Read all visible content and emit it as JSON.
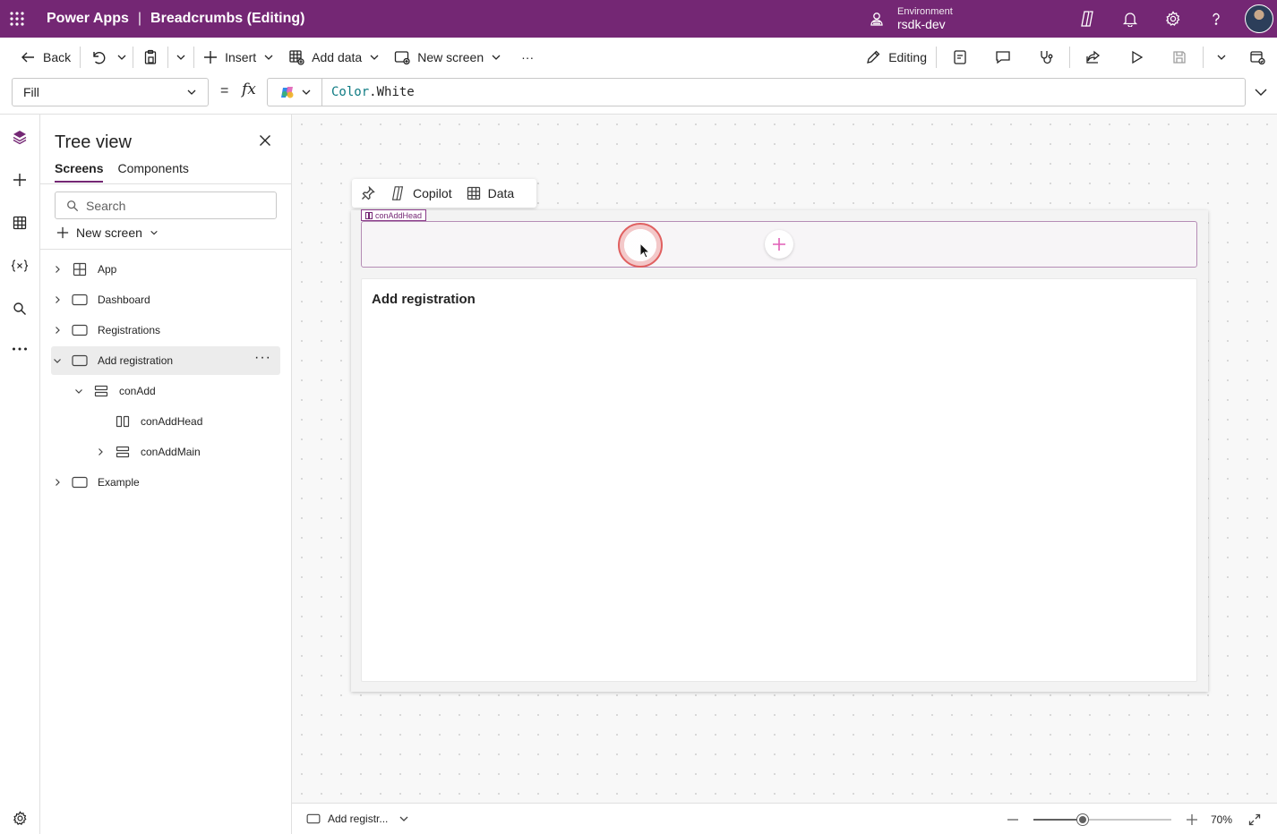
{
  "app": {
    "name": "Power Apps",
    "separator": "|",
    "title": "Breadcrumbs (Editing)"
  },
  "environment": {
    "label": "Environment",
    "value": "rsdk-dev"
  },
  "topbar": {
    "icons": [
      "copilot-icon",
      "bell-icon",
      "gear-icon",
      "help-icon",
      "avatar"
    ]
  },
  "commandbar": {
    "back": "Back",
    "insert": "Insert",
    "add_data": "Add data",
    "new_screen": "New screen",
    "more": "···",
    "editing": "Editing"
  },
  "formula": {
    "property": "Fill",
    "equals": "=",
    "fx": "fx",
    "expression_object": "Color",
    "expression_rest": ".White"
  },
  "treeview": {
    "title": "Tree view",
    "tabs": [
      {
        "label": "Screens",
        "active": true
      },
      {
        "label": "Components",
        "active": false
      }
    ],
    "search_placeholder": "Search",
    "new_screen": "New screen",
    "nodes": [
      {
        "label": "App",
        "icon": "app-icon",
        "expanded": false
      },
      {
        "label": "Dashboard",
        "icon": "screen-icon",
        "expanded": false
      },
      {
        "label": "Registrations",
        "icon": "screen-icon",
        "expanded": false
      },
      {
        "label": "Add registration",
        "icon": "screen-icon",
        "expanded": true,
        "selected": true,
        "more": "···"
      },
      {
        "label": "conAdd",
        "icon": "vertical-container-icon",
        "expanded": true
      },
      {
        "label": "conAddHead",
        "icon": "horizontal-container-icon"
      },
      {
        "label": "conAddMain",
        "icon": "vertical-container-icon",
        "expanded": false
      },
      {
        "label": "Example",
        "icon": "screen-icon",
        "expanded": false
      }
    ]
  },
  "canvas": {
    "toolbar": {
      "copilot": "Copilot",
      "data": "Data"
    },
    "head_tag": "conAddHead",
    "main_title": "Add registration"
  },
  "statusbar": {
    "screen": "Add registr...",
    "zoom": "70%",
    "zoom_level": 0.36
  },
  "colors": {
    "brand": "#742774",
    "accent_pink": "#e05fb6",
    "click_ring": "#e06060"
  }
}
